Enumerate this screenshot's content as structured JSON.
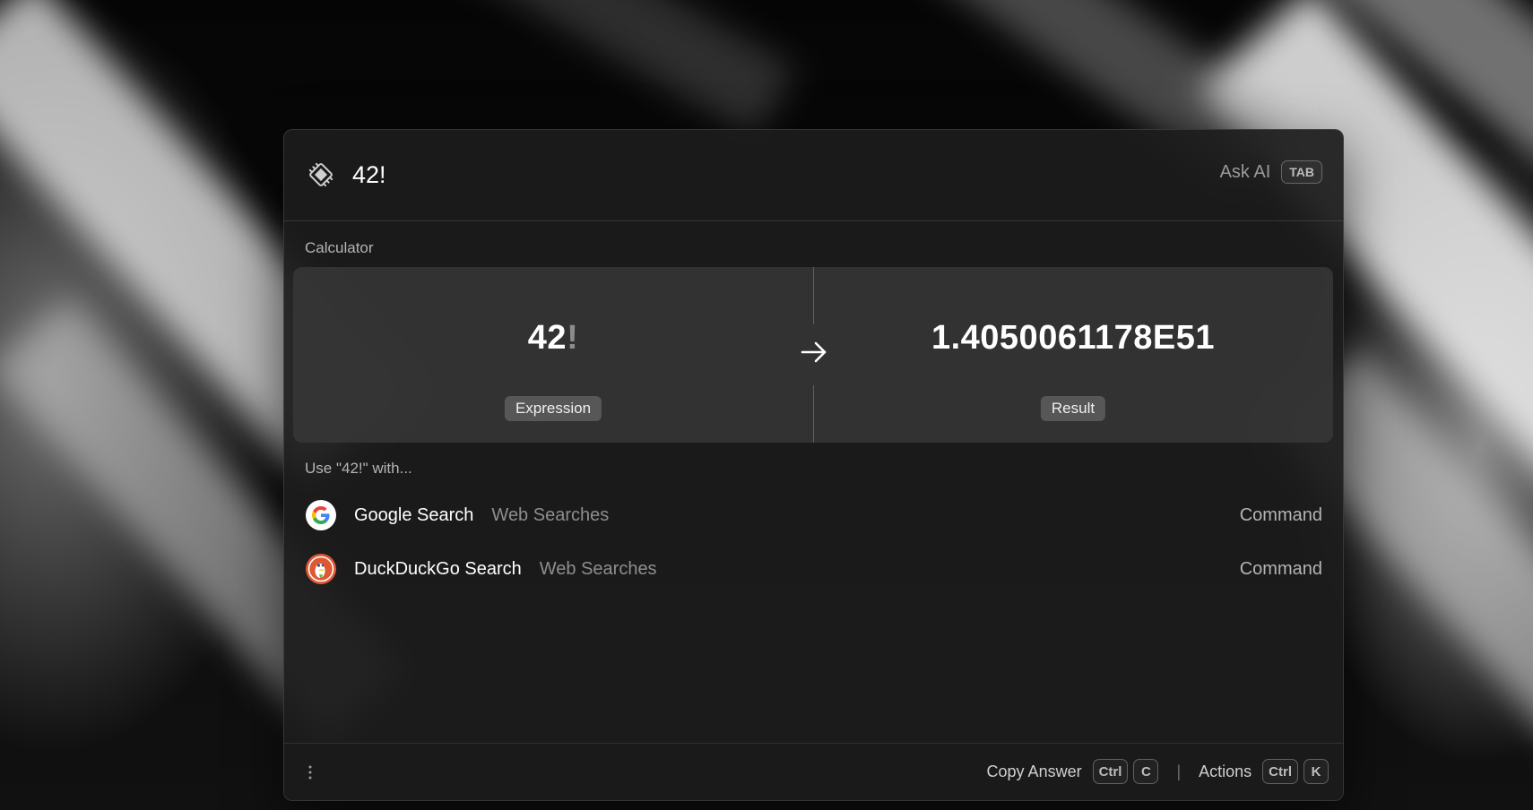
{
  "header": {
    "query": "42!",
    "ask_ai_label": "Ask AI",
    "ask_ai_key": "TAB"
  },
  "calculator": {
    "section_label": "Calculator",
    "expression_number": "42",
    "expression_operator": "!",
    "expression_tag": "Expression",
    "result_value": "1.4050061178E51",
    "result_tag": "Result"
  },
  "use_with": {
    "section_label": "Use \"42!\" with...",
    "items": [
      {
        "title": "Google Search",
        "subtitle": "Web Searches",
        "type": "Command",
        "icon": "google-icon"
      },
      {
        "title": "DuckDuckGo Search",
        "subtitle": "Web Searches",
        "type": "Command",
        "icon": "duckduckgo-icon"
      }
    ]
  },
  "footer": {
    "copy_answer_label": "Copy Answer",
    "copy_answer_keys": [
      "Ctrl",
      "C"
    ],
    "separator": "|",
    "actions_label": "Actions",
    "actions_keys": [
      "Ctrl",
      "K"
    ]
  }
}
